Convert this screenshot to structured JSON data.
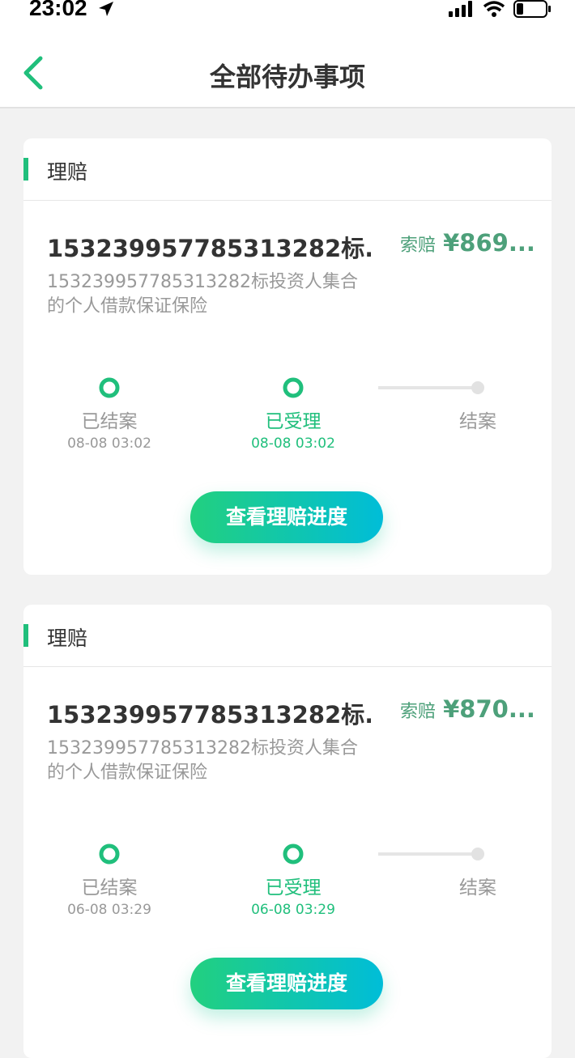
{
  "status_bar": {
    "time": "23:02"
  },
  "nav": {
    "title": "全部待办事项"
  },
  "cards": [
    {
      "type": "理赔",
      "title": "1532399577853132​82标...",
      "claim_label": "索赔",
      "claim_amount": "¥869...",
      "desc": "153239957785313282标投资人集合的个人借款保证保险",
      "steps": [
        {
          "label": "已结案",
          "time": "08-08 03:02"
        },
        {
          "label": "已受理",
          "time": "08-08 03:02"
        },
        {
          "label": "结案",
          "time": ""
        }
      ],
      "button": "查看理赔进度"
    },
    {
      "type": "理赔",
      "title": "1532399577853132​82标...",
      "claim_label": "索赔",
      "claim_amount": "¥870...",
      "desc": "153239957785313282标投资人集合的个人借款保证保险",
      "steps": [
        {
          "label": "已结案",
          "time": "06-08 03:29"
        },
        {
          "label": "已受理",
          "time": "06-08 03:29"
        },
        {
          "label": "结案",
          "time": ""
        }
      ],
      "button": "查看理赔进度"
    }
  ],
  "colors": {
    "accent": "#20bf7c",
    "amount": "#4da07a",
    "grey": "#999999"
  }
}
